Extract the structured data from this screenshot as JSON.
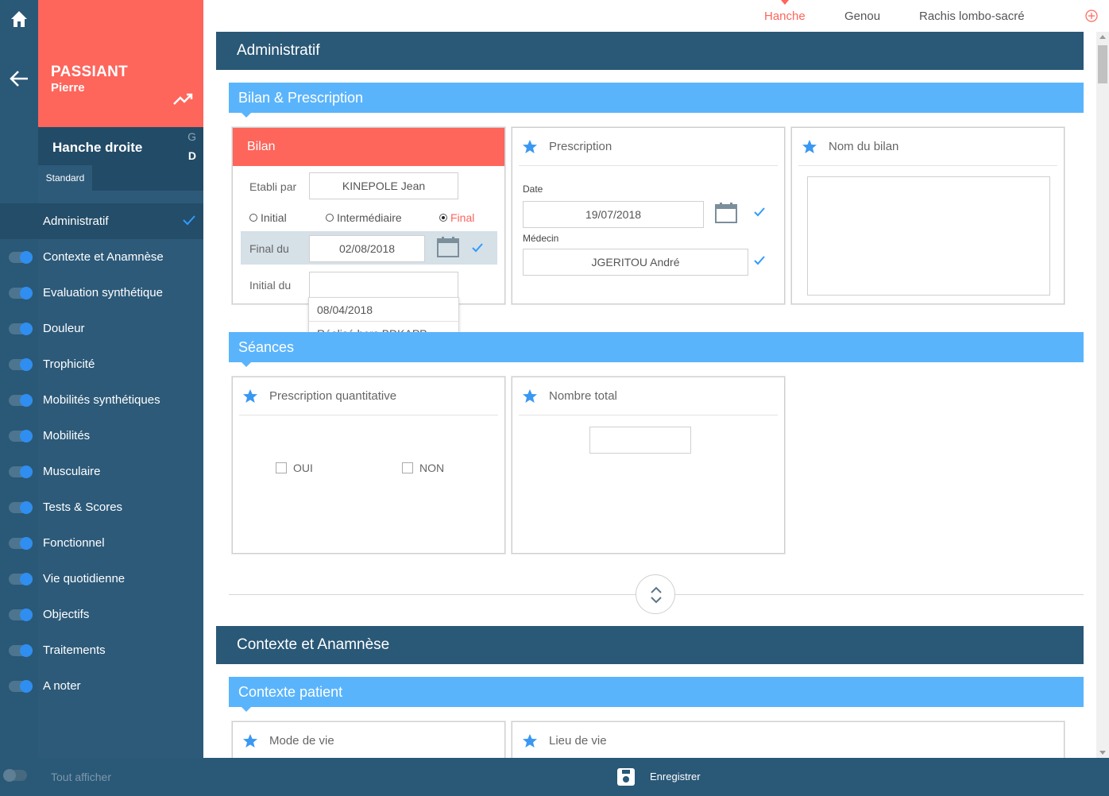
{
  "patient": {
    "last_name": "PASSIANT",
    "first_name": "Pierre"
  },
  "joint": {
    "name": "Hanche droite",
    "side_g": "G",
    "side_d": "D",
    "tab": "Standard"
  },
  "nav": [
    {
      "label": "Administratif",
      "active": true
    },
    {
      "label": "Contexte et Anamnèse"
    },
    {
      "label": "Evaluation synthétique"
    },
    {
      "label": "Douleur"
    },
    {
      "label": "Trophicité"
    },
    {
      "label": "Mobilités synthétiques"
    },
    {
      "label": "Mobilités"
    },
    {
      "label": "Musculaire"
    },
    {
      "label": "Tests & Scores"
    },
    {
      "label": "Fonctionnel"
    },
    {
      "label": "Vie quotidienne"
    },
    {
      "label": "Objectifs"
    },
    {
      "label": "Traitements"
    },
    {
      "label": "A noter"
    }
  ],
  "bottom": {
    "show_all": "Tout afficher",
    "save": "Enregistrer"
  },
  "top_tabs": {
    "hanche": "Hanche",
    "genou": "Genou",
    "rachis": "Rachis lombo-sacré"
  },
  "sections": {
    "admin": "Administratif",
    "bilan_prescription": "Bilan & Prescription",
    "seances": "Séances",
    "contexte": "Contexte et Anamnèse",
    "contexte_patient": "Contexte patient"
  },
  "bilan": {
    "title": "Bilan",
    "etabli_label": "Etabli par",
    "etabli_value": "KINEPOLE Jean",
    "radio_initial": "Initial",
    "radio_intermediaire": "Intermédiaire",
    "radio_final": "Final",
    "final_label": "Final du",
    "final_value": "02/08/2018",
    "initial_label": "Initial du",
    "initial_value": "",
    "dropdown": [
      "08/04/2018",
      "Réalisé hors BDKAPP"
    ]
  },
  "prescription": {
    "title": "Prescription",
    "date_label": "Date",
    "date_value": "19/07/2018",
    "medecin_label": "Médecin",
    "medecin_value": "JGERITOU André"
  },
  "nom_bilan": {
    "title": "Nom du bilan"
  },
  "prescription_quant": {
    "title": "Prescription quantitative",
    "oui": "OUI",
    "non": "NON"
  },
  "nombre_total": {
    "title": "Nombre total",
    "value": ""
  },
  "mode_de_vie": {
    "title": "Mode de vie"
  },
  "lieu_de_vie": {
    "title": "Lieu de vie"
  },
  "colors": {
    "accent_red": "#fe655b",
    "sidebar": "#2d5a79",
    "section": "#2a5877",
    "sub": "#5ab4fc",
    "toggle": "#2f8ef0"
  }
}
